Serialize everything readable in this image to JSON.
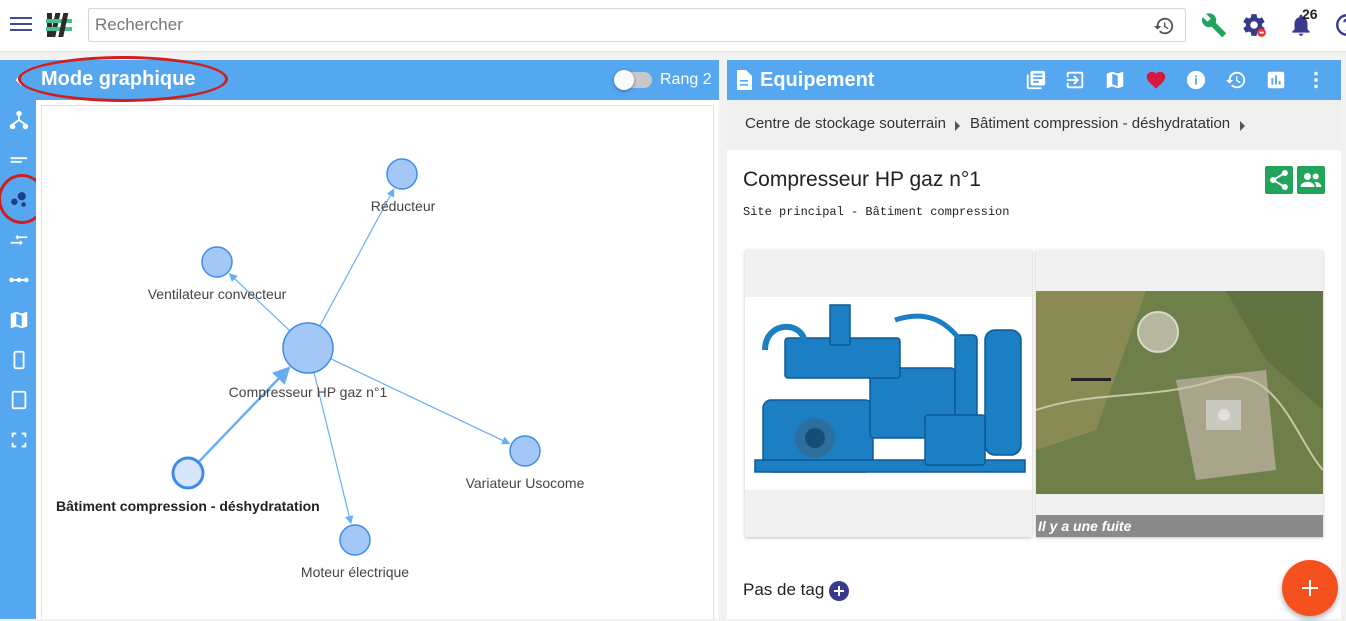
{
  "search": {
    "placeholder": "Rechercher"
  },
  "notifications": {
    "count": "26"
  },
  "graph_panel": {
    "title": "Mode graphique",
    "rank_label": "Rang 2",
    "rank_toggle_on": false,
    "nodes": [
      {
        "id": "center",
        "label": "Compresseur HP gaz n°1",
        "bold": false
      },
      {
        "id": "reducteur",
        "label": "Réducteur",
        "bold": false
      },
      {
        "id": "ventilateur",
        "label": "Ventilateur convecteur",
        "bold": false
      },
      {
        "id": "variateur",
        "label": "Variateur Usocome",
        "bold": false
      },
      {
        "id": "moteur",
        "label": "Moteur électrique",
        "bold": false
      },
      {
        "id": "batiment",
        "label": "Bâtiment compression - déshydratation",
        "bold": true
      }
    ]
  },
  "equip_panel": {
    "title": "Equipement",
    "breadcrumb": [
      "Centre de stockage souterrain",
      "Bâtiment compression - déshydratation"
    ],
    "name": "Compresseur HP gaz n°1",
    "subtitle": "Site principal - Bâtiment compression",
    "image_caption": "Il y a une fuite",
    "tags_label": "Pas de tag"
  },
  "colors": {
    "primary": "#55a7f0",
    "node_fill": "#a3c8f7",
    "node_stroke": "#3f8be6",
    "share_green": "#21a45b",
    "fab": "#f4511e",
    "annotation_red": "#d11f1f",
    "heart": "#d8183a"
  },
  "icons": {
    "header": [
      "library-books-icon",
      "exit-to-app-icon",
      "map-icon",
      "favorite-icon",
      "info-icon",
      "history-icon",
      "bar-chart-icon",
      "more-vert-icon"
    ],
    "rail": [
      "hierarchy-icon",
      "short-text-icon",
      "bubble-chart-icon",
      "compare-arrows-icon",
      "linear-scale-icon",
      "map-icon",
      "phone-portrait-icon",
      "tablet-icon",
      "fullscreen-icon"
    ]
  }
}
